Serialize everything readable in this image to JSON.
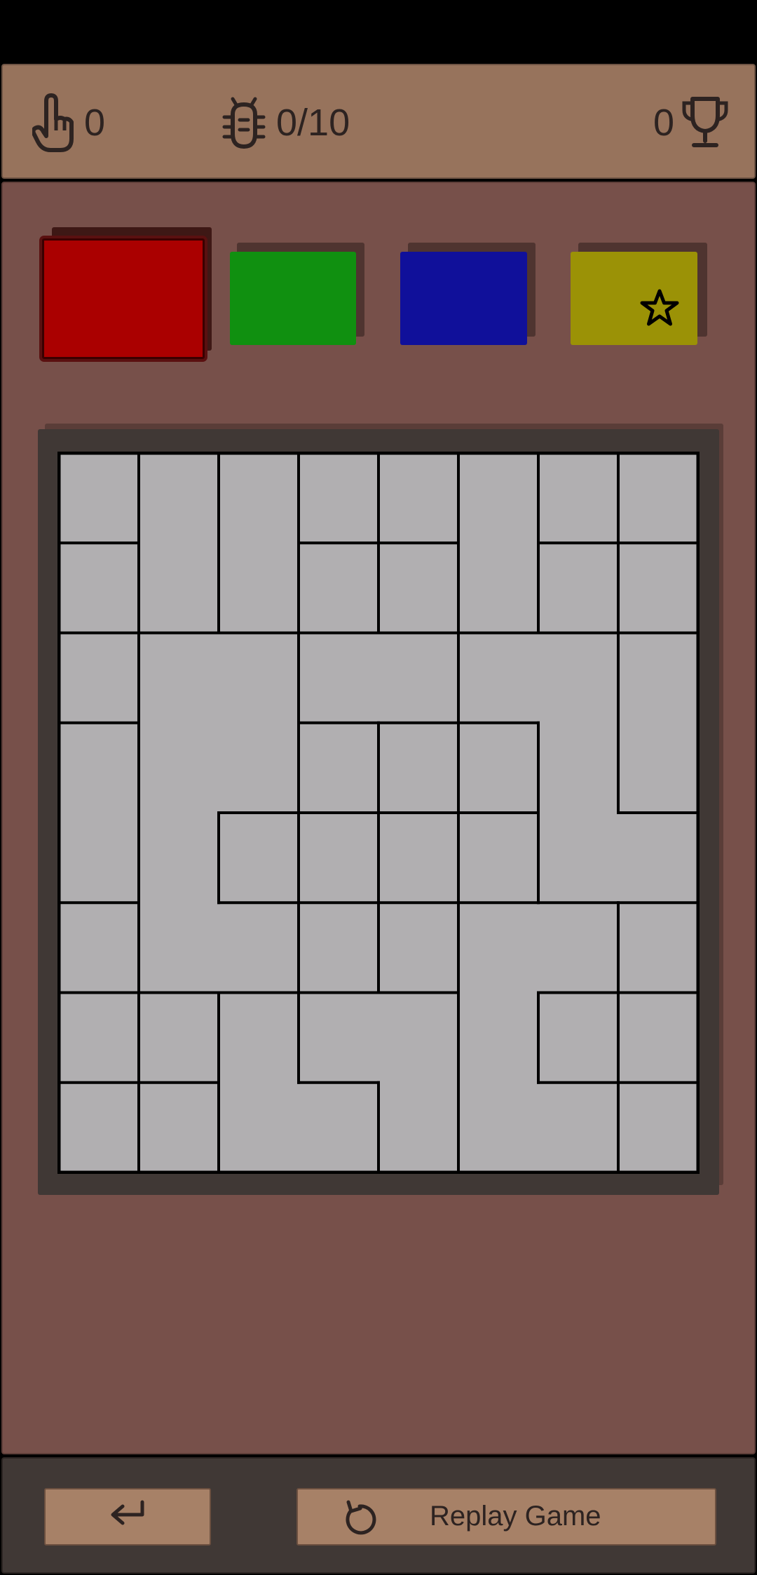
{
  "header": {
    "taps_count": "0",
    "bugs_progress": "0/10",
    "trophy_count": "0",
    "icons": [
      "tap-hand-icon",
      "bug-icon",
      "trophy-icon"
    ]
  },
  "color_palette": [
    {
      "name": "red",
      "color": "#aa0000",
      "selected": true,
      "starred": false
    },
    {
      "name": "green",
      "color": "#109010",
      "selected": false,
      "starred": false
    },
    {
      "name": "blue",
      "color": "#10109a",
      "selected": false,
      "starred": false
    },
    {
      "name": "yellow",
      "color": "#9b9206",
      "selected": false,
      "starred": true
    }
  ],
  "board": {
    "rows": 8,
    "cols": 8,
    "cell_color": "#b1afb1",
    "line_color": "#000000",
    "regions": [
      [
        0,
        1,
        2,
        3,
        4,
        5,
        6,
        7
      ],
      [
        8,
        1,
        2,
        9,
        10,
        5,
        11,
        12
      ],
      [
        13,
        14,
        14,
        15,
        15,
        16,
        16,
        17
      ],
      [
        18,
        14,
        14,
        19,
        20,
        21,
        16,
        17
      ],
      [
        18,
        14,
        22,
        23,
        24,
        25,
        16,
        16
      ],
      [
        26,
        14,
        14,
        27,
        28,
        29,
        29,
        30
      ],
      [
        31,
        32,
        33,
        34,
        34,
        29,
        35,
        36
      ],
      [
        37,
        38,
        33,
        33,
        34,
        29,
        29,
        39
      ]
    ]
  },
  "footer": {
    "back_icon": "return-arrow-icon",
    "replay_icon": "replay-icon",
    "replay_label": "Replay Game"
  }
}
